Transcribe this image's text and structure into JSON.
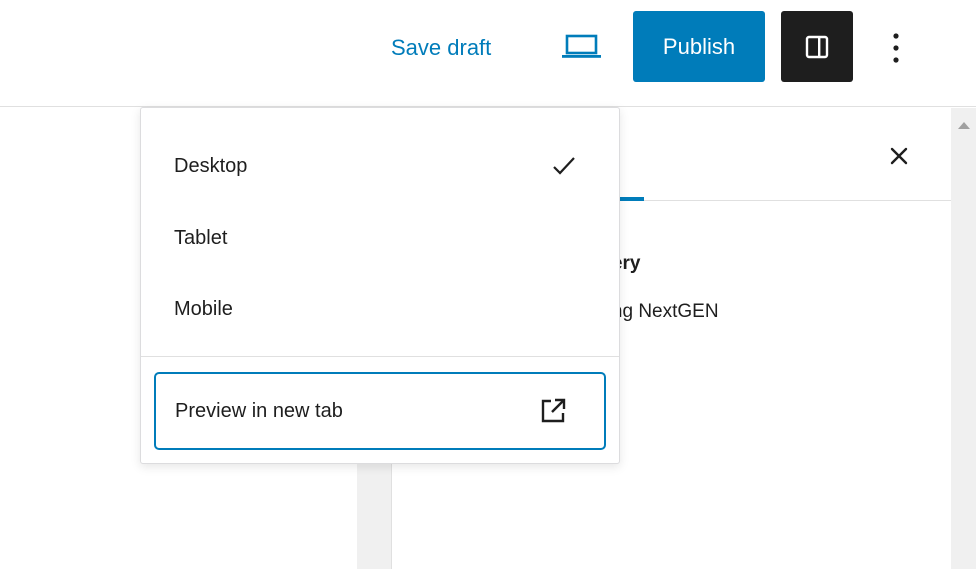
{
  "toolbar": {
    "save_draft_label": "Save draft",
    "preview_icon": "laptop-icon",
    "publish_label": "Publish",
    "settings_icon": "sidebar-toggle-icon",
    "options_icon": "vertical-ellipsis-icon"
  },
  "preview_menu": {
    "items": [
      {
        "label": "Desktop",
        "selected": true
      },
      {
        "label": "Tablet",
        "selected": false
      },
      {
        "label": "Mobile",
        "selected": false
      }
    ],
    "new_tab_label": "Preview in new tab",
    "new_tab_icon": "external-link-icon"
  },
  "sidebar": {
    "close_icon": "close-icon",
    "block_title": "Gallery",
    "block_description": "adding NextGEN"
  },
  "colors": {
    "accent": "#007cba",
    "dark": "#1e1e1e",
    "canvas": "#f0f0f0"
  }
}
